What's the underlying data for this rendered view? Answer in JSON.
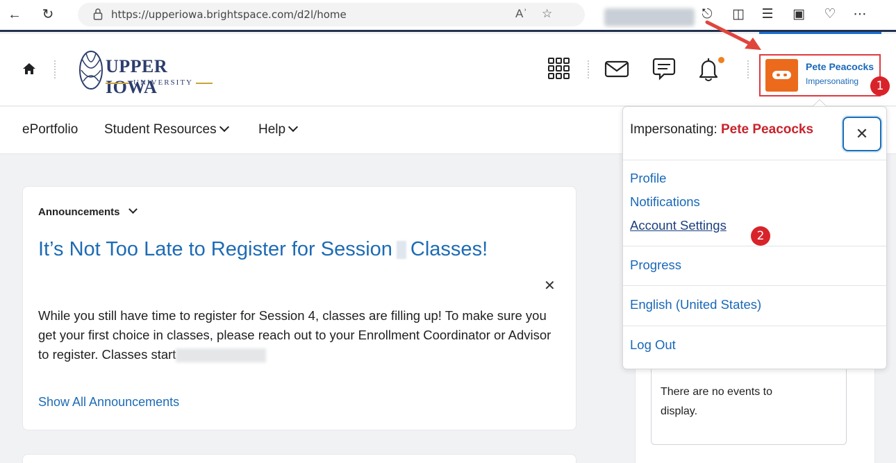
{
  "browser": {
    "url": "https://upperiowa.brightspace.com/d2l/home",
    "read_aloud_icon": "Aʾ"
  },
  "header": {
    "logo_title": "UPPER IOWA",
    "logo_subtitle": "UNIVERSITY",
    "user_name": "Pete Peacocks",
    "user_status": "Impersonating"
  },
  "nav": {
    "items": [
      "ePortfolio",
      "Student Resources",
      "Help"
    ]
  },
  "announcement": {
    "header": "Announcements",
    "title_part1": "It’s Not Too Late to Register for Session",
    "title_part2": "Classes!",
    "body": "While you still have time to register for Session 4, classes are filling up! To make sure you get your first choice in classes, please reach out to your Enrollment Coordinator or Advisor to register. Classes start",
    "show_all": "Show All Announcements"
  },
  "calendar": {
    "empty_text": "There are no events to display."
  },
  "dropdown": {
    "title_prefix": "Impersonating:",
    "title_name": "Pete Peacocks",
    "close": "✕",
    "links": [
      "Profile",
      "Notifications",
      "Account Settings",
      "Progress",
      "English (United States)",
      "Log Out"
    ]
  },
  "annotations": {
    "badge1": "1",
    "badge2": "2"
  },
  "colors": {
    "accent": "#1968b8",
    "highlight_red": "#e0393e",
    "avatar_orange": "#ec6a1c",
    "brand_navy": "#2c3d6d"
  }
}
